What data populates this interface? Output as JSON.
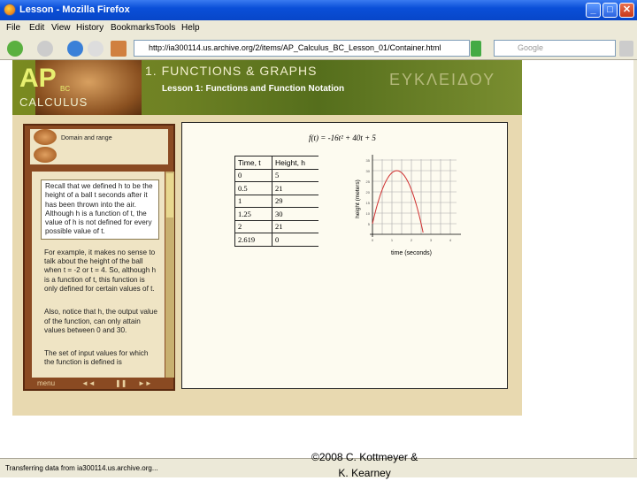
{
  "window": {
    "title": "Lesson - Mozilla Firefox"
  },
  "menu": [
    "File",
    "Edit",
    "View",
    "History",
    "Bookmarks",
    "Tools",
    "Help"
  ],
  "toolbar": {
    "url": "http://ia300114.us.archive.org/2/items/AP_Calculus_BC_Lesson_01/Container.html",
    "search_placeholder": "Google"
  },
  "banner": {
    "ap": "AP",
    "bc": "BC",
    "calculus": "CALCULUS",
    "unit": "1. FUNCTIONS & GRAPHS",
    "lesson": "Lesson 1: Functions and Function Notation",
    "greek": "ΕΥΚΛΕΙΔΟΥ"
  },
  "sidebar": {
    "title": "Domain and range",
    "recall": "Recall that we defined h to be the height of a ball t seconds after it has been thrown into the air. Although h is a function of t, the value of h is not defined for every possible value of t.",
    "paragraphs": [
      "For example, it makes no sense to talk about the height of the ball when t = -2 or t = 4. So, although h is a function of t, this function is only defined for certain values of t.",
      "Also, notice that h, the output value of the function, can only attain values between 0 and 30.",
      "The set of input values for which the function is defined is"
    ],
    "controls": {
      "menu": "menu",
      "rewind": "◄◄",
      "pause": "❚❚",
      "forward": "►►"
    }
  },
  "main": {
    "formula": "f(t) = -16t² + 40t + 5",
    "table": {
      "headers": [
        "Time, t",
        "Height, h"
      ],
      "rows": [
        [
          "0",
          "5"
        ],
        [
          "0.5",
          "21"
        ],
        [
          "1",
          "29"
        ],
        [
          "1.25",
          "30"
        ],
        [
          "2",
          "21"
        ],
        [
          "2.619",
          "0"
        ]
      ]
    },
    "graph": {
      "xlabel": "time (seconds)",
      "ylabel": "height (meters)",
      "xticks": [
        "0",
        "1",
        "2",
        "3",
        "4"
      ],
      "yticks": [
        "5",
        "10",
        "15",
        "20",
        "25",
        "30",
        "35"
      ],
      "curve_color": "#d03030"
    }
  },
  "status": {
    "text": "Transferring data from ia300114.us.archive.org...",
    "copyright_line1": "©2008 C. Kottmeyer &",
    "copyright_line2": "K. Kearney"
  }
}
